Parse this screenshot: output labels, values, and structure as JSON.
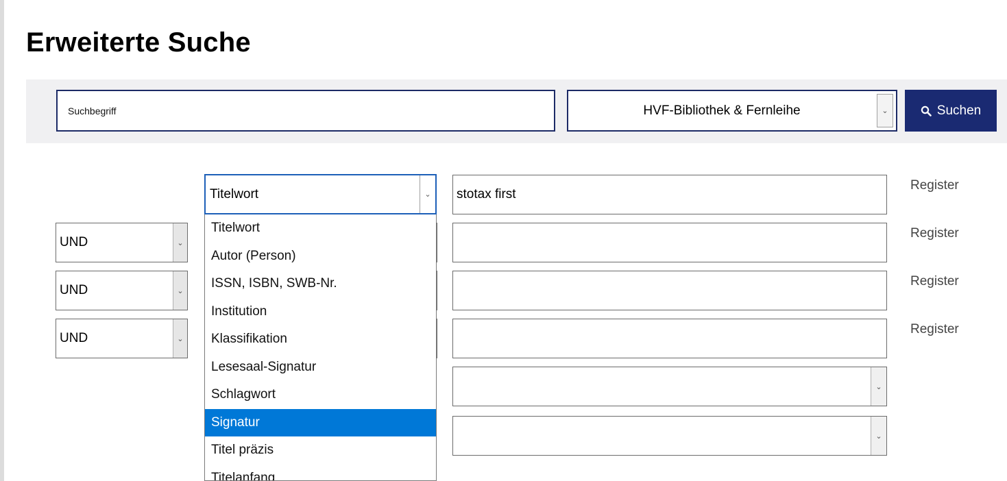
{
  "page": {
    "title": "Erweiterte Suche"
  },
  "searchbar": {
    "placeholder": "Suchbegriff",
    "library_value": "HVF-Bibliothek & Fernleihe",
    "search_label": "Suchen"
  },
  "advanced": {
    "field_select_value": "Titelwort",
    "register_label": "Register",
    "rows": [
      {
        "operator": "",
        "term": "stotax first"
      },
      {
        "operator": "UND",
        "term": ""
      },
      {
        "operator": "UND",
        "term": ""
      },
      {
        "operator": "UND",
        "term": ""
      }
    ],
    "dropdown_options": [
      "Titelwort",
      "Autor (Person)",
      "ISSN, ISBN, SWB-Nr.",
      "Institution",
      "Klassifikation",
      "Lesesaal-Signatur",
      "Schlagwort",
      "Signatur",
      "Titel präzis",
      "Titelanfang"
    ],
    "highlighted_option": "Signatur"
  },
  "colors": {
    "primary_navy": "#1a2a72",
    "focus_blue": "#1c5fb8",
    "highlight_blue": "#0078d7",
    "searchbar_bg": "#f0f0f2"
  },
  "icons": {
    "search": "magnifier-icon",
    "dropdown": "chevron-down-icon"
  }
}
